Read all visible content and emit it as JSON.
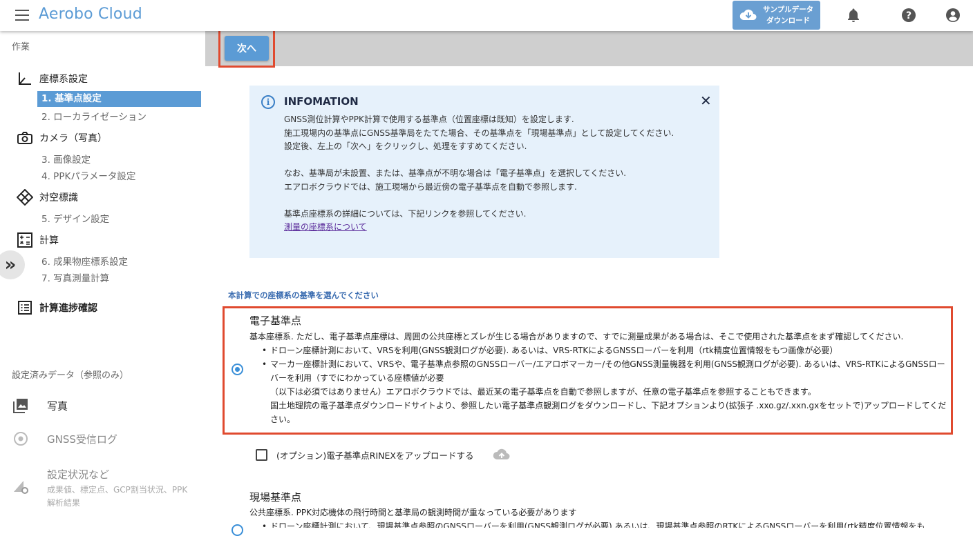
{
  "app": {
    "title": "Aerobo Cloud"
  },
  "header": {
    "sample_download_line1": "サンプルデータ",
    "sample_download_line2": "ダウンロード"
  },
  "toolbar": {
    "next_label": "次へ"
  },
  "sidebar": {
    "work_section": "作業",
    "groups": [
      {
        "label": "座標系設定",
        "icon": "axis-icon",
        "items": [
          {
            "label": "1. 基準点設定",
            "active": true
          },
          {
            "label": "2. ローカライゼーション"
          }
        ]
      },
      {
        "label": "カメラ（写真）",
        "icon": "camera-icon",
        "items": [
          {
            "label": "3. 画像設定"
          },
          {
            "label": "4. PPKパラメータ設定"
          }
        ]
      },
      {
        "label": "対空標識",
        "icon": "target-marker-icon",
        "items": [
          {
            "label": "5. デザイン設定"
          }
        ]
      },
      {
        "label": "計算",
        "icon": "calculator-icon",
        "items": [
          {
            "label": "6. 成果物座標系設定"
          },
          {
            "label": "7. 写真測量計算"
          }
        ]
      },
      {
        "label": "計算進捗確認",
        "icon": "list-icon",
        "items": []
      }
    ],
    "ref_section": "設定済みデータ（参照のみ）",
    "ref_items": [
      {
        "label": "写真",
        "icon": "photo-icon"
      },
      {
        "label": "GNSS受信ログ",
        "icon": "radio-target-icon"
      },
      {
        "label": "設定状況など",
        "sub": "成果値、標定点、GCP割当状況、PPK解析結果",
        "icon": "settings-status-icon"
      }
    ]
  },
  "info": {
    "title": "INFOMATION",
    "lines": [
      "GNSS測位計算やPPK計算で使用する基準点（位置座標は既知）を設定します.",
      "施工現場内の基準点にGNSS基準局をたてた場合、その基準点を「現場基準点」として設定してください.",
      "設定後、左上の「次へ」をクリックし、処理をすすめてください.",
      "",
      "なお、基準局が未設置、または、基準点が不明な場合は「電子基準点」を選択してください.",
      "エアロボクラウドでは、施工現場から最近傍の電子基準点を自動で参照します.",
      "",
      "基準点座標系の詳細については、下記リンクを参照してください."
    ],
    "link": "測量の座標系について"
  },
  "prompt": "本計算での座標系の基準を選んでください",
  "options": [
    {
      "title": "電子基準点",
      "selected": true,
      "desc": "基本座標系. ただし、電子基準点座標は、周囲の公共座標とズレが生じる場合がありますので、すでに測量成果がある場合は、そこで使用された基準点をまず確認してください.",
      "bullet1": "ドローン座標計測において、VRSを利用(GNSS観測ログが必要). あるいは、VRS-RTKによるGNSSローバーを利用（rtk精度位置情報をもつ画像が必要）",
      "bullet2": "マーカー座標計測において、VRSや、電子基準点参照のGNSSローバー/エアロボマーカー/その他GNSS測量機器を利用(GNSS観測ログが必要). あるいは、VRS-RTKによるGNSSローバーを利用（すでにわかっている座標値が必要",
      "note1": "（以下は必須ではありません）エアロボクラウドでは、最近某の電子基準点を自動で参照しますが、任意の電子基準点を参照することもできます。",
      "note2": "国土地理院の電子基準点ダウンロードサイトより、参照したい電子基準点観測ログをダウンロードし、下記オプションより(拡張子 .xxo.gz/.xxn.gxをセットで)アップロードしてください。"
    },
    {
      "title": "現場基準点",
      "selected": false,
      "desc": "公共座標系. PPK対応機体の飛行時間と基準局の観測時間が重なっている必要があります",
      "bullet1": "ドローン座標計測において、現場基準点参照のGNSSローバーを利用(GNSS観測ログが必要) あるいは、現場基準点参照のRTKによるGNSSローバーを利用(rtk精度位置情報をも"
    }
  ],
  "upload_option": {
    "label": "(オプション)電子基準点RINEXをアップロードする",
    "checked": false
  },
  "colors": {
    "accent": "#5b9bd5",
    "highlight": "#e04a2f",
    "info_bg": "#e6f1fb"
  }
}
